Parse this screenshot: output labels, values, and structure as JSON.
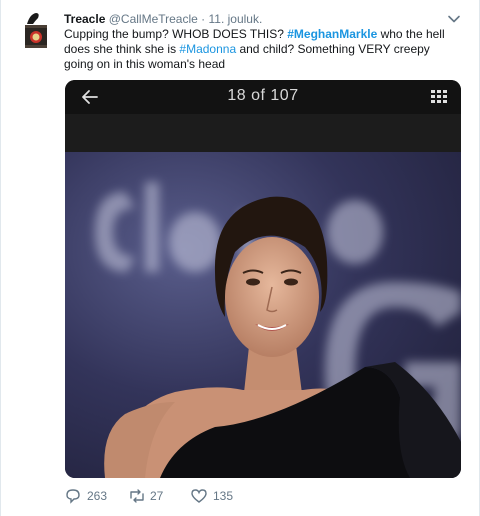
{
  "tweet": {
    "name": "Treacle",
    "handle": "@CallMeTreacle",
    "separator": "·",
    "date": "11. jouluk.",
    "text_parts": {
      "t1": "Cupping the bump? WHOB DOES THIS? ",
      "tag1": "#MeghanMarkle",
      "t2": " who the hell does she think she is ",
      "tag2": "#Madonna",
      "t3": " and child? Something VERY creepy going on in this woman's head"
    }
  },
  "media": {
    "counter": "18 of 107",
    "icons": {
      "back": "back-arrow-icon",
      "grid": "grid-icon",
      "menu": "chevron-down-icon"
    }
  },
  "actions": {
    "replies": "263",
    "retweets": "27",
    "likes": "135"
  },
  "colors": {
    "link": "#1b95e0",
    "muted": "#657786",
    "text": "#14171a"
  }
}
